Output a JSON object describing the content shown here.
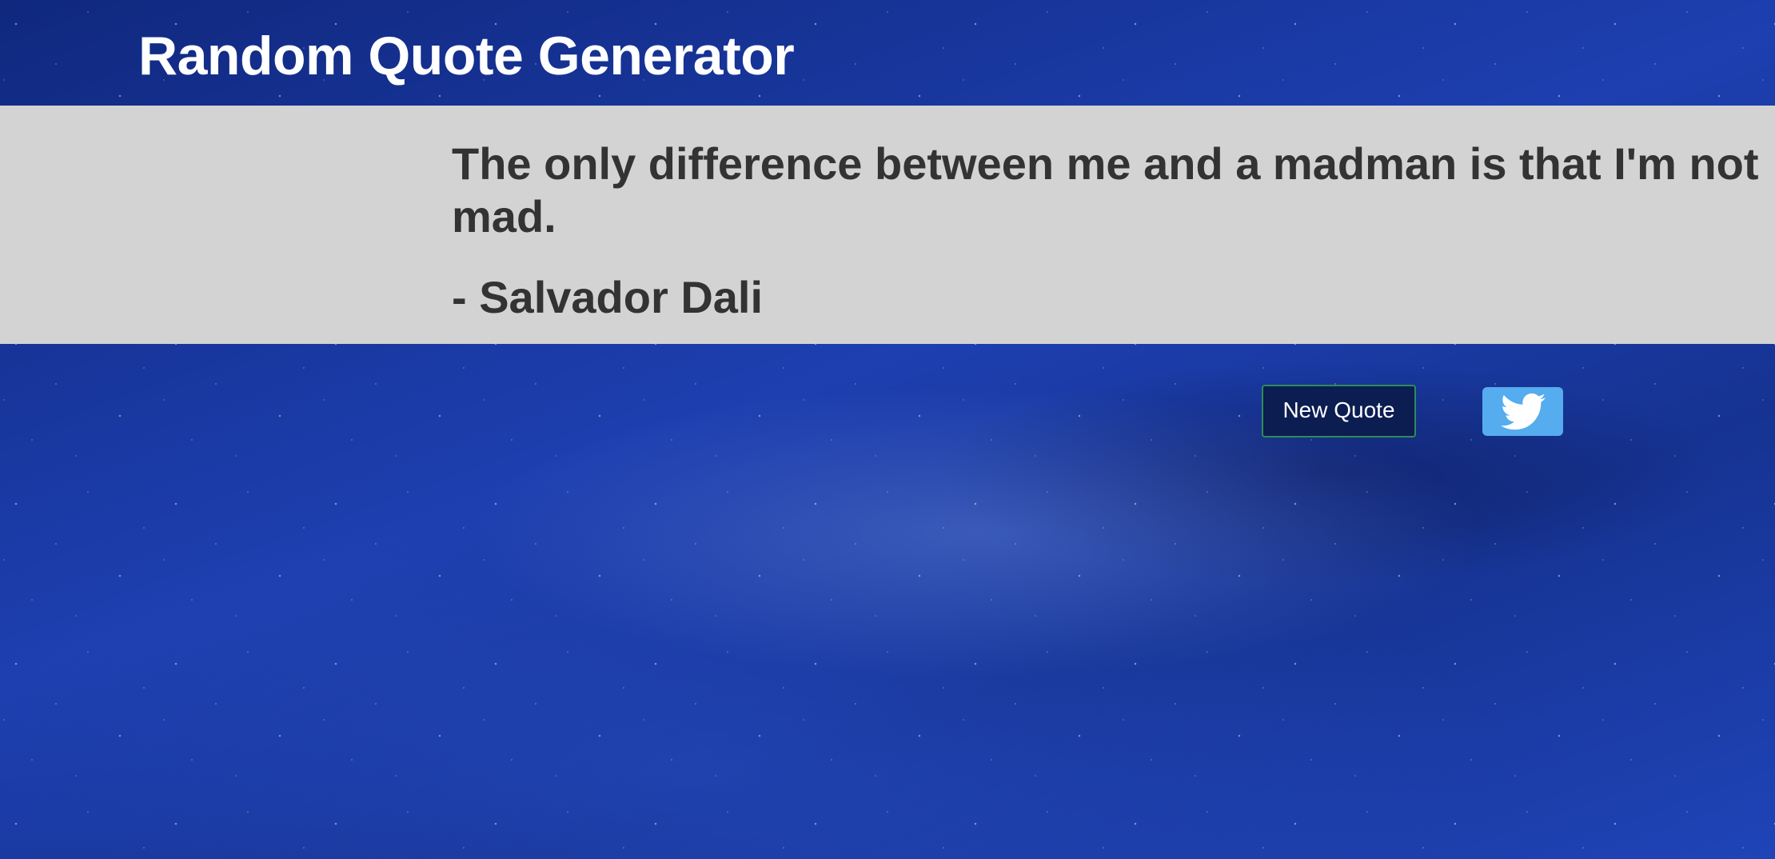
{
  "header": {
    "title": "Random Quote Generator"
  },
  "quote": {
    "text": "The only difference between me and a madman is that I'm not mad.",
    "author": "- Salvador Dali"
  },
  "actions": {
    "new_quote_label": "New Quote",
    "tweet_icon": "twitter-bird-icon"
  },
  "colors": {
    "panel_background": "#d3d3d3",
    "quote_text": "#333333",
    "new_quote_button": "#0c1d52",
    "new_quote_border": "#2e8b57",
    "twitter_button": "#55acee"
  }
}
